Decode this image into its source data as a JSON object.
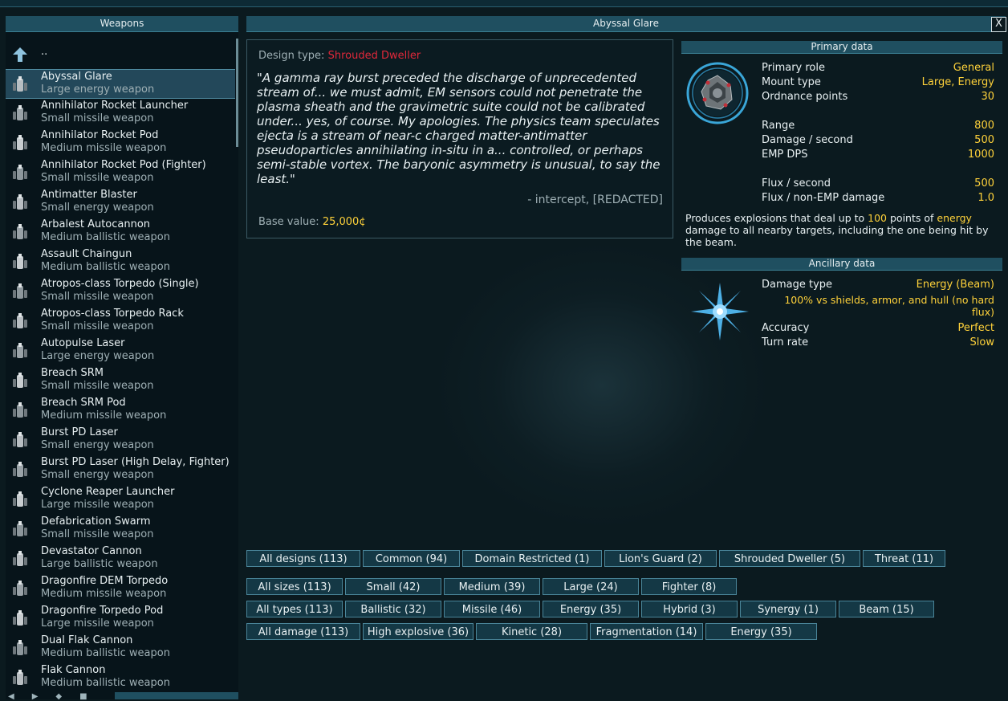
{
  "left_panel": {
    "title": "Weapons",
    "up_label": "..",
    "items": [
      {
        "name": "Abyssal Glare",
        "type": "Large energy weapon",
        "selected": true
      },
      {
        "name": "Annihilator Rocket Launcher",
        "type": "Small missile weapon"
      },
      {
        "name": "Annihilator Rocket Pod",
        "type": "Medium missile weapon"
      },
      {
        "name": "Annihilator Rocket Pod (Fighter)",
        "type": "Small missile weapon"
      },
      {
        "name": "Antimatter Blaster",
        "type": "Small energy weapon"
      },
      {
        "name": "Arbalest Autocannon",
        "type": "Medium ballistic weapon"
      },
      {
        "name": "Assault Chaingun",
        "type": "Medium ballistic weapon"
      },
      {
        "name": "Atropos-class Torpedo (Single)",
        "type": "Small missile weapon"
      },
      {
        "name": "Atropos-class Torpedo Rack",
        "type": "Small missile weapon"
      },
      {
        "name": "Autopulse Laser",
        "type": "Large energy weapon"
      },
      {
        "name": "Breach SRM",
        "type": "Small missile weapon"
      },
      {
        "name": "Breach SRM Pod",
        "type": "Medium missile weapon"
      },
      {
        "name": "Burst PD Laser",
        "type": "Small energy weapon"
      },
      {
        "name": "Burst PD Laser (High Delay, Fighter)",
        "type": "Small energy weapon"
      },
      {
        "name": "Cyclone Reaper Launcher",
        "type": "Large missile weapon"
      },
      {
        "name": "Defabrication Swarm",
        "type": "Small missile weapon"
      },
      {
        "name": "Devastator Cannon",
        "type": "Large ballistic weapon"
      },
      {
        "name": "Dragonfire DEM Torpedo",
        "type": "Medium missile weapon"
      },
      {
        "name": "Dragonfire Torpedo Pod",
        "type": "Large missile weapon"
      },
      {
        "name": "Dual Flak Cannon",
        "type": "Medium ballistic weapon"
      },
      {
        "name": "Flak Cannon",
        "type": "Medium ballistic weapon"
      }
    ]
  },
  "main": {
    "title": "Abyssal Glare",
    "close_label": "X",
    "design_type_label": "Design type:",
    "design_type": "Shrouded Dweller",
    "quote": "\"A gamma ray burst preceded the discharge of unprecedented stream of... we must admit, EM sensors could not penetrate the plasma sheath and the gravimetric suite could not be calibrated under... yes, of course. My apologies. The physics team speculates ejecta is a stream of near-c charged matter-antimatter pseudoparticles annihilating in-situ in a... controlled, or perhaps semi-stable vortex. The baryonic asymmetry is unusual, to say the least.\"",
    "attribution": "- intercept, [REDACTED]",
    "base_value_label": "Base value:",
    "base_value": "25,000¢"
  },
  "primary": {
    "title": "Primary data",
    "stats": [
      {
        "label": "Primary role",
        "value": "General"
      },
      {
        "label": "Mount type",
        "value": "Large, Energy"
      },
      {
        "label": "Ordnance points",
        "value": "30"
      },
      {
        "label": "Range",
        "value": "800"
      },
      {
        "label": "Damage / second",
        "value": "500"
      },
      {
        "label": "EMP DPS",
        "value": "1000"
      },
      {
        "label": "Flux / second",
        "value": "500"
      },
      {
        "label": "Flux / non-EMP damage",
        "value": "1.0"
      }
    ],
    "note": {
      "p1": "Produces explosions that deal up to ",
      "n1": "100",
      "p2": " points of ",
      "n2": "energy",
      "p3": " damage to all nearby targets, including the one being hit by the beam."
    }
  },
  "ancillary": {
    "title": "Ancillary data",
    "damage_type_label": "Damage type",
    "damage_type": "Energy (Beam)",
    "damage_note": "100% vs shields, armor, and hull (no hard flux)",
    "accuracy_label": "Accuracy",
    "accuracy": "Perfect",
    "turn_rate_label": "Turn rate",
    "turn_rate": "Slow"
  },
  "filters": {
    "designs": [
      "All designs (113)",
      "Common (94)",
      "Domain Restricted (1)",
      "Lion's Guard (2)",
      "Shrouded Dweller (5)",
      "Threat (11)"
    ],
    "sizes": [
      "All sizes (113)",
      "Small (42)",
      "Medium (39)",
      "Large (24)",
      "Fighter (8)"
    ],
    "types": [
      "All types (113)",
      "Ballistic (32)",
      "Missile (46)",
      "Energy (35)",
      "Hybrid (3)",
      "Synergy (1)",
      "Beam (15)"
    ],
    "damage": [
      "All damage (113)",
      "High explosive (36)",
      "Kinetic (28)",
      "Fragmentation (14)",
      "Energy (35)"
    ]
  },
  "colors": {
    "highlight": "#ffd23a",
    "design_red": "#e0283a",
    "header_bg": "#1f4f60"
  }
}
